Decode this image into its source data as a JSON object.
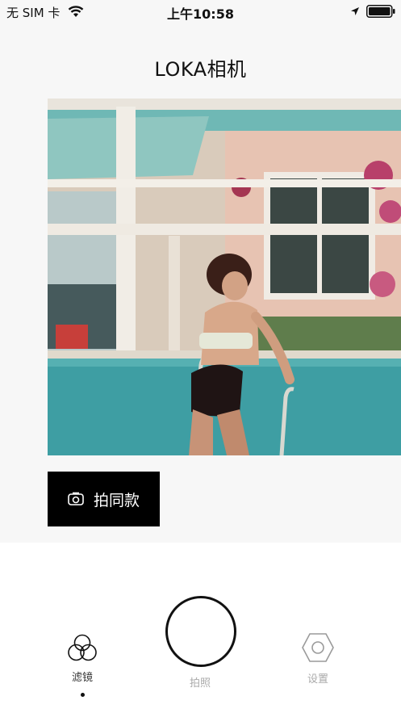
{
  "status_bar": {
    "carrier": "无 SIM 卡",
    "time": "上午10:58"
  },
  "header": {
    "title": "LOKA相机"
  },
  "photo": {
    "subject": "woman in bikini climbing pool ladder"
  },
  "actions": {
    "take_same_label": "拍同款"
  },
  "tab_bar": {
    "filter_label": "滤镜",
    "shoot_label": "拍照",
    "settings_label": "设置",
    "active_tab": "filter"
  },
  "colors": {
    "background_top": "#f7f7f7",
    "button_bg": "#000000",
    "pool_water": "#3e9ea3",
    "wall_pink": "#e8cbbd"
  }
}
